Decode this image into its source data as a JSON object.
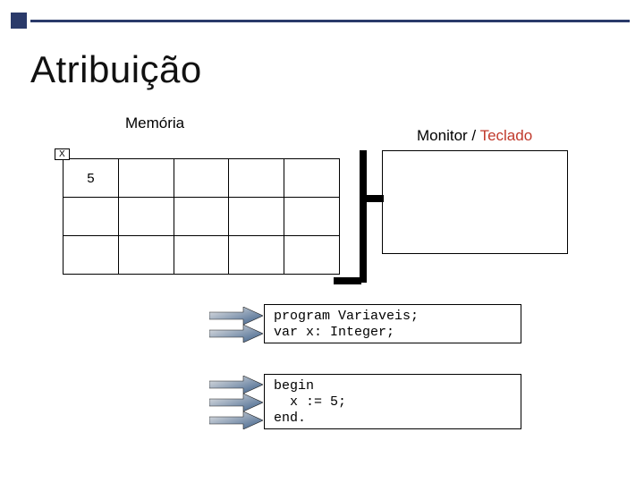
{
  "title": "Atribuição",
  "labels": {
    "memoria": "Memória",
    "monitor": "Monitor / ",
    "teclado": "Teclado"
  },
  "memory": {
    "var_tag": "X",
    "var_value": "5"
  },
  "code": {
    "block1_line1": "program Variaveis;",
    "block1_line2": "var x: Integer;",
    "block2_line1": "begin",
    "block2_line2": "  x := 5;",
    "block2_line3": "end."
  }
}
